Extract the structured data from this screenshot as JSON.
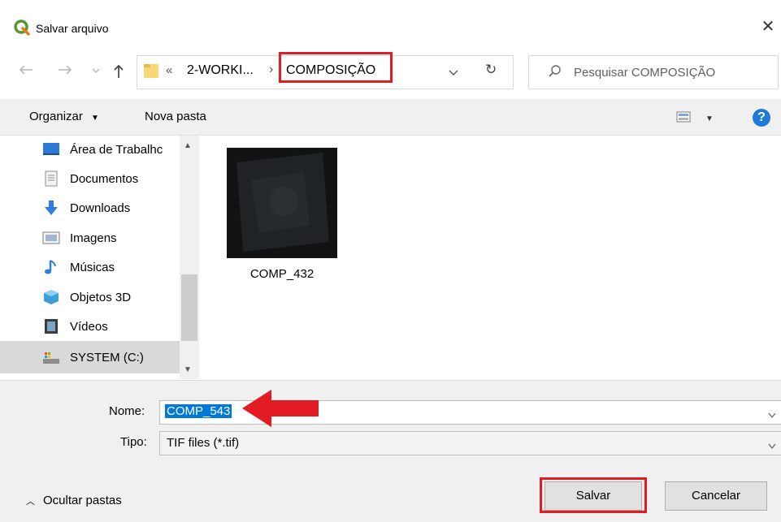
{
  "window": {
    "title": "Salvar arquivo",
    "close_glyph": "✕"
  },
  "address": {
    "overflow": "«",
    "crumb1": "2-WORKI...",
    "separator": "›",
    "current": "COMPOSIÇÃO",
    "dropdown_glyph": "⌄",
    "refresh_glyph": "↻"
  },
  "search": {
    "placeholder": "Pesquisar COMPOSIÇÃO"
  },
  "toolbar": {
    "organize": "Organizar",
    "new_folder": "Nova pasta",
    "help": "?"
  },
  "nav_items": [
    {
      "label": "Área de Trabalhc",
      "icon": "desktop-icon"
    },
    {
      "label": "Documentos",
      "icon": "documents-icon"
    },
    {
      "label": "Downloads",
      "icon": "downloads-icon"
    },
    {
      "label": "Imagens",
      "icon": "pictures-icon"
    },
    {
      "label": "Músicas",
      "icon": "music-icon"
    },
    {
      "label": "Objetos 3D",
      "icon": "3d-objects-icon"
    },
    {
      "label": "Vídeos",
      "icon": "videos-icon"
    },
    {
      "label": "SYSTEM (C:)",
      "icon": "drive-icon"
    }
  ],
  "files": [
    {
      "name": "COMP_432"
    }
  ],
  "form": {
    "name_label": "Nome:",
    "name_value": "COMP_543",
    "type_label": "Tipo:",
    "type_value": "TIF files (*.tif)"
  },
  "footer": {
    "hide_folders": "Ocultar pastas",
    "save": "Salvar",
    "cancel": "Cancelar"
  },
  "colors": {
    "highlight": "#e31b23",
    "selection": "#0078d7",
    "accent_blue": "#1e7ad6"
  }
}
